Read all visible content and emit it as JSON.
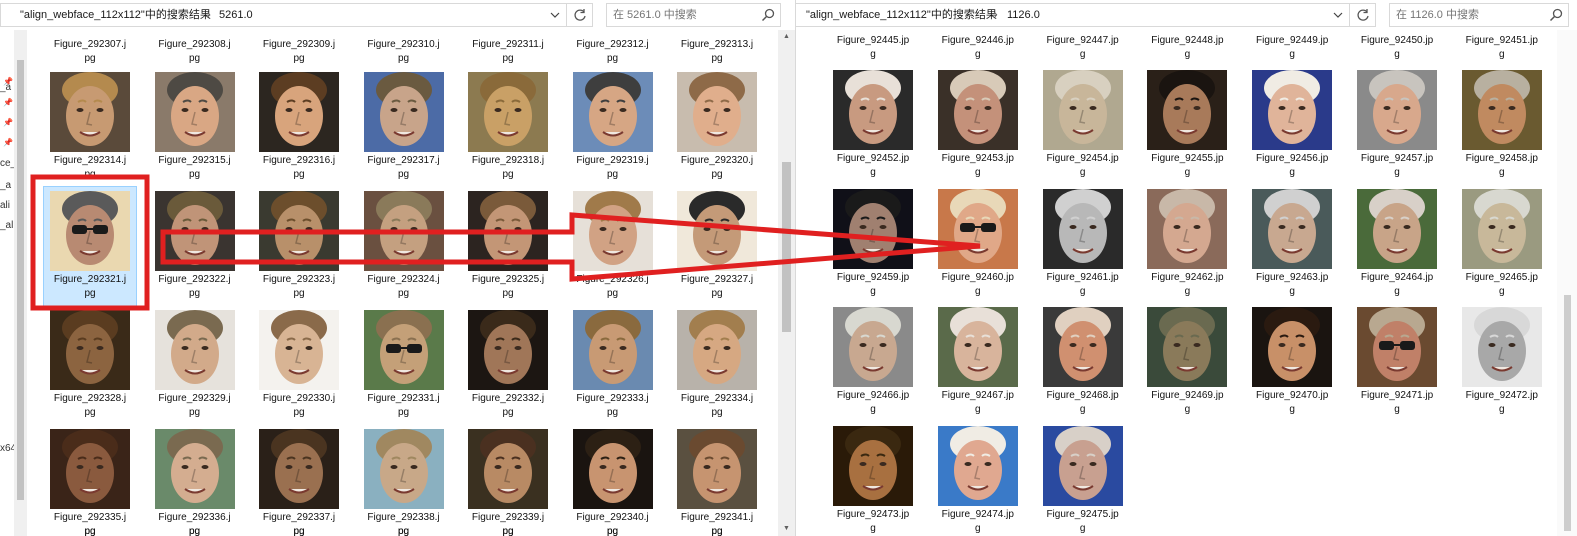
{
  "left_window": {
    "breadcrumb": "\"align_webface_112x112\"中的搜索结果",
    "folder": "5261.0",
    "search_placeholder": "在 5261.0 中搜索",
    "nav_fragments": [
      "_a",
      "ce_",
      "_a",
      "ali",
      "_ali",
      "x64"
    ],
    "top_captions": [
      "Figure_292307.j",
      "Figure_292308.j",
      "Figure_292309.j",
      "Figure_292310.j",
      "Figure_292311.j",
      "Figure_292312.j",
      "Figure_292313.j"
    ],
    "top_captions2": [
      "pg",
      "pg",
      "pg",
      "pg",
      "pg",
      "pg",
      "pg"
    ],
    "rows": [
      [
        {
          "l1": "Figure_292314.j",
          "l2": "pg",
          "skin": "#c79a72",
          "hair": "#b48a4e",
          "bg": "#5a4a3a"
        },
        {
          "l1": "Figure_292315.j",
          "l2": "pg",
          "skin": "#d9a784",
          "hair": "#4e4a44",
          "bg": "#8a7a6a"
        },
        {
          "l1": "Figure_292316.j",
          "l2": "pg",
          "skin": "#d8a47c",
          "hair": "#5c3d22",
          "bg": "#2c2620"
        },
        {
          "l1": "Figure_292317.j",
          "l2": "pg",
          "skin": "#c8a48a",
          "hair": "#6a5a40",
          "bg": "#4c6ba6"
        },
        {
          "l1": "Figure_292318.j",
          "l2": "pg",
          "skin": "#c9a066",
          "hair": "#8a6a3a",
          "bg": "#8c7a50"
        },
        {
          "l1": "Figure_292319.j",
          "l2": "pg",
          "skin": "#d6a684",
          "hair": "#3e3e3e",
          "bg": "#6c8cb8"
        },
        {
          "l1": "Figure_292320.j",
          "l2": "pg",
          "skin": "#e0ae8c",
          "hair": "#8e6a48",
          "bg": "#c8bcae"
        }
      ],
      [
        {
          "l1": "Figure_292321.j",
          "l2": "pg",
          "skin": "#b88a72",
          "hair": "#5a5a5a",
          "bg": "#ead8b0",
          "glasses": true
        },
        {
          "l1": "Figure_292322.j",
          "l2": "pg",
          "skin": "#c09478",
          "hair": "#6a5a3a",
          "bg": "#3a3430"
        },
        {
          "l1": "Figure_292323.j",
          "l2": "pg",
          "skin": "#b8906a",
          "hair": "#6c4e2c",
          "bg": "#3a3a30"
        },
        {
          "l1": "Figure_292324.j",
          "l2": "pg",
          "skin": "#c4a080",
          "hair": "#8a7a5a",
          "bg": "#6a5040"
        },
        {
          "l1": "Figure_292325.j",
          "l2": "pg",
          "skin": "#c39676",
          "hair": "#7a5a3a",
          "bg": "#2c2420"
        },
        {
          "l1": "Figure_292326.j",
          "l2": "pg",
          "skin": "#d1a284",
          "hair": "#a07a4a",
          "bg": "#e6e0d8"
        },
        {
          "l1": "Figure_292327.j",
          "l2": "pg",
          "skin": "#c49a78",
          "hair": "#2a2a2a",
          "bg": "#f0e8da"
        }
      ],
      [
        {
          "l1": "Figure_292328.j",
          "l2": "pg",
          "skin": "#8c6440",
          "hair": "#5a3c20",
          "bg": "#3a2a18"
        },
        {
          "l1": "Figure_292329.j",
          "l2": "pg",
          "skin": "#d2aa8a",
          "hair": "#7a6a50",
          "bg": "#e6e2dc"
        },
        {
          "l1": "Figure_292330.j",
          "l2": "pg",
          "skin": "#d8b494",
          "hair": "#8a6a4a",
          "bg": "#f4f2ee"
        },
        {
          "l1": "Figure_292331.j",
          "l2": "pg",
          "skin": "#c4a078",
          "hair": "#8a7050",
          "bg": "#5a7a4a",
          "glasses": true
        },
        {
          "l1": "Figure_292332.j",
          "l2": "pg",
          "skin": "#a07658",
          "hair": "#3a2a1a",
          "bg": "#1c1612"
        },
        {
          "l1": "Figure_292333.j",
          "l2": "pg",
          "skin": "#c89a74",
          "hair": "#8a6a3e",
          "bg": "#6a8ab0"
        },
        {
          "l1": "Figure_292334.j",
          "l2": "pg",
          "skin": "#d6a882",
          "hair": "#a27e4e",
          "bg": "#b8b2aa"
        }
      ],
      [
        {
          "l1": "Figure_292335.j",
          "l2": "pg",
          "skin": "#8a5a3e",
          "hair": "#4a2c1a",
          "bg": "#3a2418"
        },
        {
          "l1": "Figure_292336.j",
          "l2": "pg",
          "skin": "#d4ad90",
          "hair": "#7a6a50",
          "bg": "#6a8a6a"
        },
        {
          "l1": "Figure_292337.j",
          "l2": "pg",
          "skin": "#9a7050",
          "hair": "#4a3420",
          "bg": "#2a2018"
        },
        {
          "l1": "Figure_292338.j",
          "l2": "pg",
          "skin": "#c8a888",
          "hair": "#a08860",
          "bg": "#8ab0c0"
        },
        {
          "l1": "Figure_292339.j",
          "l2": "pg",
          "skin": "#b88a64",
          "hair": "#4a3020",
          "bg": "#3a3020"
        },
        {
          "l1": "Figure_292340.j",
          "l2": "pg",
          "skin": "#c89470",
          "hair": "#2c2014",
          "bg": "#1a1410"
        },
        {
          "l1": "Figure_292341.j",
          "l2": "pg",
          "skin": "#c69470",
          "hair": "#6a4a30",
          "bg": "#5a5040"
        }
      ]
    ],
    "partial_row_caption": "pg"
  },
  "right_window": {
    "breadcrumb": "\"align_webface_112x112\"中的搜索结果",
    "folder": "1126.0",
    "search_placeholder": "在 1126.0 中搜索",
    "top_captions": [
      "Figure_92445.jp",
      "Figure_92446.jp",
      "Figure_92447.jp",
      "Figure_92448.jp",
      "Figure_92449.jp",
      "Figure_92450.jp",
      "Figure_92451.jp"
    ],
    "top_captions2": [
      "g",
      "g",
      "g",
      "g",
      "g",
      "g",
      "g"
    ],
    "rows": [
      [
        {
          "l1": "Figure_92452.jp",
          "l2": "g",
          "skin": "#c89a80",
          "hair": "#e8e0d8",
          "bg": "#2a2a2a"
        },
        {
          "l1": "Figure_92453.jp",
          "l2": "g",
          "skin": "#c4917a",
          "hair": "#d8cab8",
          "bg": "#3a3028"
        },
        {
          "l1": "Figure_92454.jp",
          "l2": "g",
          "skin": "#c8b69a",
          "hair": "#d8d0c0",
          "bg": "#b0a890"
        },
        {
          "l1": "Figure_92455.jp",
          "l2": "g",
          "skin": "#a87a5a",
          "hair": "#1a1410",
          "bg": "#2a2018"
        },
        {
          "l1": "Figure_92456.jp",
          "l2": "g",
          "skin": "#e0b49a",
          "hair": "#f0ece4",
          "bg": "#2a3a8a"
        },
        {
          "l1": "Figure_92457.jp",
          "l2": "g",
          "skin": "#d8a88c",
          "hair": "#c8c4be",
          "bg": "#8a8a8a"
        },
        {
          "l1": "Figure_92458.jp",
          "l2": "g",
          "skin": "#c08a60",
          "hair": "#b8b0a0",
          "bg": "#6a5a30"
        }
      ],
      [
        {
          "l1": "Figure_92459.jp",
          "l2": "g",
          "skin": "#a08070",
          "hair": "#1a1a1a",
          "bg": "#101018"
        },
        {
          "l1": "Figure_92460.jp",
          "l2": "g",
          "skin": "#e0a888",
          "hair": "#e8d8b8",
          "bg": "#c8784a",
          "glasses": true
        },
        {
          "l1": "Figure_92461.jp",
          "l2": "g",
          "skin": "#b8b8b8",
          "hair": "#d0d0d0",
          "bg": "#2a2a2a"
        },
        {
          "l1": "Figure_92462.jp",
          "l2": "g",
          "skin": "#d4a890",
          "hair": "#c8b8a8",
          "bg": "#8a6a5a"
        },
        {
          "l1": "Figure_92463.jp",
          "l2": "g",
          "skin": "#c8a890",
          "hair": "#d0d0d0",
          "bg": "#4a5a5a"
        },
        {
          "l1": "Figure_92464.jp",
          "l2": "g",
          "skin": "#c8a488",
          "hair": "#d8d0c8",
          "bg": "#4a6a3a"
        },
        {
          "l1": "Figure_92465.jp",
          "l2": "g",
          "skin": "#c8b89a",
          "hair": "#d8d8d0",
          "bg": "#9a9a80"
        }
      ],
      [
        {
          "l1": "Figure_92466.jp",
          "l2": "g",
          "skin": "#c8a890",
          "hair": "#d8d8d0",
          "bg": "#8a8a8a"
        },
        {
          "l1": "Figure_92467.jp",
          "l2": "g",
          "skin": "#d8b49c",
          "hair": "#e8e0d8",
          "bg": "#5a6a4a"
        },
        {
          "l1": "Figure_92468.jp",
          "l2": "g",
          "skin": "#d09070",
          "hair": "#e0d0c0",
          "bg": "#3a3a3a"
        },
        {
          "l1": "Figure_92469.jp",
          "l2": "g",
          "skin": "#8a7a5a",
          "hair": "#6a6a50",
          "bg": "#3a4a3a"
        },
        {
          "l1": "Figure_92470.jp",
          "l2": "g",
          "skin": "#c89068",
          "hair": "#2a1a10",
          "bg": "#1a1410"
        },
        {
          "l1": "Figure_92471.jp",
          "l2": "g",
          "skin": "#c08068",
          "hair": "#b8a890",
          "bg": "#6a4a30",
          "glasses": true
        },
        {
          "l1": "Figure_92472.jp",
          "l2": "g",
          "skin": "#a8a8a8",
          "hair": "#d8d8d8",
          "bg": "#e8e8e8"
        }
      ],
      [
        {
          "l1": "Figure_92473.jp",
          "l2": "g",
          "skin": "#a87040",
          "hair": "#3a2810",
          "bg": "#2a1a08"
        },
        {
          "l1": "Figure_92474.jp",
          "l2": "g",
          "skin": "#e0a890",
          "hair": "#f0ece4",
          "bg": "#3a7ac8"
        },
        {
          "l1": "Figure_92475.jp",
          "l2": "g",
          "skin": "#c8a090",
          "hair": "#d8d0c8",
          "bg": "#2a4aa0"
        }
      ]
    ]
  },
  "annotation": {
    "box_color": "#e02020",
    "arrow_color": "#e02020"
  },
  "icons": {
    "dropdown": "chevron-down-icon",
    "refresh": "refresh-icon",
    "search": "search-icon",
    "pin": "pin-icon",
    "breadcrumb_separator": "chevron-right-icon"
  }
}
